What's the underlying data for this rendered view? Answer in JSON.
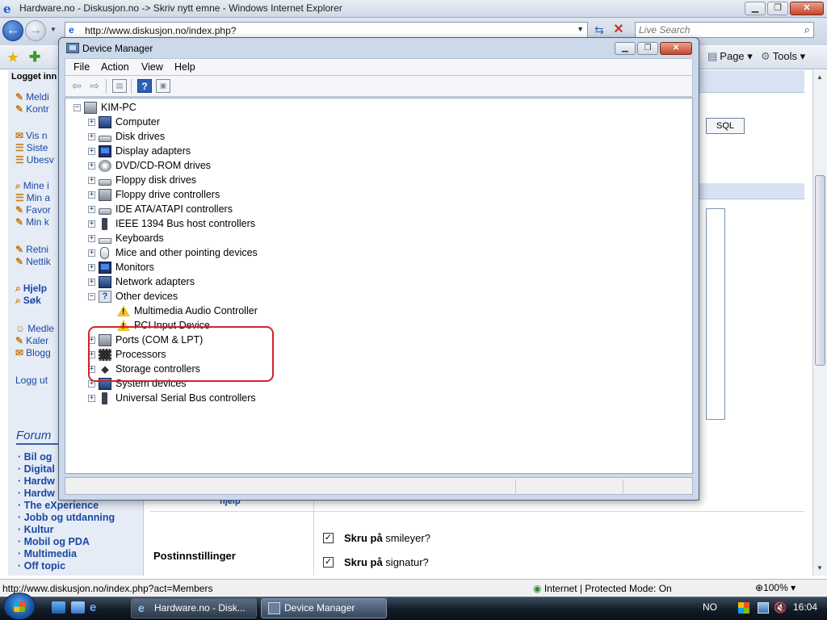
{
  "ie": {
    "title": "Hardware.no - Diskusjon.no -> Skriv nytt emne - Windows Internet Explorer",
    "address": "http://www.diskusjon.no/index.php?",
    "search_placeholder": "Live Search",
    "cmd_page": "Page",
    "cmd_tools": "Tools",
    "status_url": "http://www.diskusjon.no/index.php?act=Members",
    "status_zone": "Internet | Protected Mode: On",
    "zoom": "100%"
  },
  "web": {
    "logged_in": "Logget inn",
    "menu_group1": [
      "Meldi",
      "Kontr"
    ],
    "menu_group2": [
      "Vis n",
      "Siste",
      "Ubesv"
    ],
    "menu_group3": [
      "Mine i",
      "Min a",
      "Favor",
      "Min k"
    ],
    "menu_group4": [
      "Retni",
      "Nettik"
    ],
    "help_links": [
      "Hjelp",
      "Søk"
    ],
    "menu_group5": [
      "Medle",
      "Kaler",
      "Blogg"
    ],
    "logout": "Logg ut",
    "forum_head": "Forum",
    "forum_links": [
      "· Bil og",
      "· Digital",
      "· Hardw",
      "· Hardw",
      "· The eXperience",
      "· Jobb og utdanning",
      "· Kultur",
      "· Mobil og PDA",
      "· Multimedia",
      "· Off topic"
    ],
    "sql_button": "SQL",
    "hjelp": "hjelp",
    "post_settings_label": "Postinnstillinger",
    "checkbox1": {
      "bold": "Skru på",
      "rest": " smileyer?"
    },
    "checkbox2": {
      "bold": "Skru på",
      "rest": " signatur?"
    }
  },
  "device_manager": {
    "title": "Device Manager",
    "menus": [
      "File",
      "Action",
      "View",
      "Help"
    ],
    "root": "KIM-PC",
    "categories": [
      {
        "label": "Computer",
        "icon": "computer-icon",
        "expanded": false
      },
      {
        "label": "Disk drives",
        "icon": "disk-drive-icon",
        "expanded": false
      },
      {
        "label": "Display adapters",
        "icon": "display-adapter-icon",
        "expanded": false
      },
      {
        "label": "DVD/CD-ROM drives",
        "icon": "cdrom-icon",
        "expanded": false
      },
      {
        "label": "Floppy disk drives",
        "icon": "floppy-icon",
        "expanded": false
      },
      {
        "label": "Floppy drive controllers",
        "icon": "controller-icon",
        "expanded": false
      },
      {
        "label": "IDE ATA/ATAPI controllers",
        "icon": "ide-icon",
        "expanded": false
      },
      {
        "label": "IEEE 1394 Bus host controllers",
        "icon": "usb-icon",
        "expanded": false
      },
      {
        "label": "Keyboards",
        "icon": "keyboard-icon",
        "expanded": false
      },
      {
        "label": "Mice and other pointing devices",
        "icon": "mouse-icon",
        "expanded": false
      },
      {
        "label": "Monitors",
        "icon": "monitor-icon",
        "expanded": false
      },
      {
        "label": "Network adapters",
        "icon": "network-icon",
        "expanded": false
      },
      {
        "label": "Other devices",
        "icon": "unknown-device-icon",
        "expanded": true
      },
      {
        "label": "Ports (COM & LPT)",
        "icon": "port-icon",
        "expanded": false
      },
      {
        "label": "Processors",
        "icon": "processor-icon",
        "expanded": false
      },
      {
        "label": "Storage controllers",
        "icon": "storage-icon",
        "expanded": false
      },
      {
        "label": "System devices",
        "icon": "system-icon",
        "expanded": false
      },
      {
        "label": "Universal Serial Bus controllers",
        "icon": "usb-icon",
        "expanded": false
      }
    ],
    "other_devices_children": [
      "Multimedia Audio Controller",
      "PCI Input Device"
    ],
    "highlight_color": "#d3222b"
  },
  "taskbar": {
    "buttons": [
      "Hardware.no - Disk...",
      "Device Manager"
    ],
    "language": "NO",
    "clock": "16:04"
  }
}
